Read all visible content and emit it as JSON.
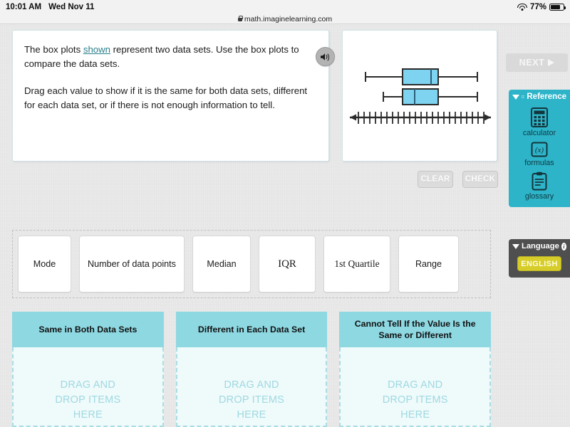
{
  "status_bar": {
    "time": "10:01 AM",
    "date": "Wed Nov 11",
    "battery_percent": "77%",
    "wifi_icon": "wifi-icon",
    "battery_icon": "battery-icon"
  },
  "browser": {
    "url": "math.imaginelearning.com",
    "lock_icon": "lock-icon"
  },
  "question": {
    "line1_before": "The box plots ",
    "line1_link": "shown",
    "line1_after": " represent two data sets. Use the box plots to compare the data sets.",
    "line2": "Drag each value to show if it is the same for both data sets, different for each data set, or if there is not enough information to tell.",
    "speaker_icon": "speaker-icon"
  },
  "figure": {
    "type": "box-plot-pair",
    "description": "Two horizontal box plots above a tick-marked number line with arrows on both ends",
    "number_line": {
      "tick_count": 23,
      "arrows": "both-ends"
    },
    "plots": [
      {
        "name": "upper-box-plot",
        "min": 3,
        "q1": 9,
        "median": 15,
        "q3": 16,
        "max": 22
      },
      {
        "name": "lower-box-plot",
        "min": 5,
        "q1": 9,
        "median": 11,
        "q3": 15,
        "max": 22
      }
    ],
    "box_fill": "#7ed4f0",
    "box_stroke": "#111111"
  },
  "actions": {
    "clear_label": "CLEAR",
    "check_label": "CHECK"
  },
  "tiles": [
    {
      "label": "Mode",
      "size": "w-mode"
    },
    {
      "label": "Number of data points",
      "size": "w-ndp"
    },
    {
      "label": "Median",
      "size": "w-med"
    },
    {
      "label": "IQR",
      "size": "w-iqr"
    },
    {
      "label": "1st Quartile",
      "size": "w-q1"
    },
    {
      "label": "Range",
      "size": "w-range"
    }
  ],
  "dropzones": [
    {
      "title": "Same in Both Data Sets",
      "hint_line1": "DRAG AND",
      "hint_line2": "DROP ITEMS",
      "hint_line3": "HERE"
    },
    {
      "title": "Different in Each Data Set",
      "hint_line1": "DRAG AND",
      "hint_line2": "DROP ITEMS",
      "hint_line3": "HERE"
    },
    {
      "title": "Cannot Tell If the Value Is the Same or Different",
      "hint_line1": "DRAG AND",
      "hint_line2": "DROP ITEMS",
      "hint_line3": "HERE"
    }
  ],
  "right_rail": {
    "next_label": "NEXT",
    "reference": {
      "title": "Reference",
      "items": [
        {
          "label": "calculator",
          "icon": "calculator-icon"
        },
        {
          "label": "formulas",
          "icon": "formulas-icon"
        },
        {
          "label": "glossary",
          "icon": "glossary-icon"
        }
      ]
    },
    "language": {
      "title": "Language",
      "selected": "ENGLISH",
      "info_glyph": "i"
    }
  },
  "colors": {
    "teal_header": "#8ed8e2",
    "reference_panel": "#2eb4c9",
    "dropzone_body": "#effafa",
    "english_button": "#d6cd2b",
    "link": "#2a7f8c"
  }
}
